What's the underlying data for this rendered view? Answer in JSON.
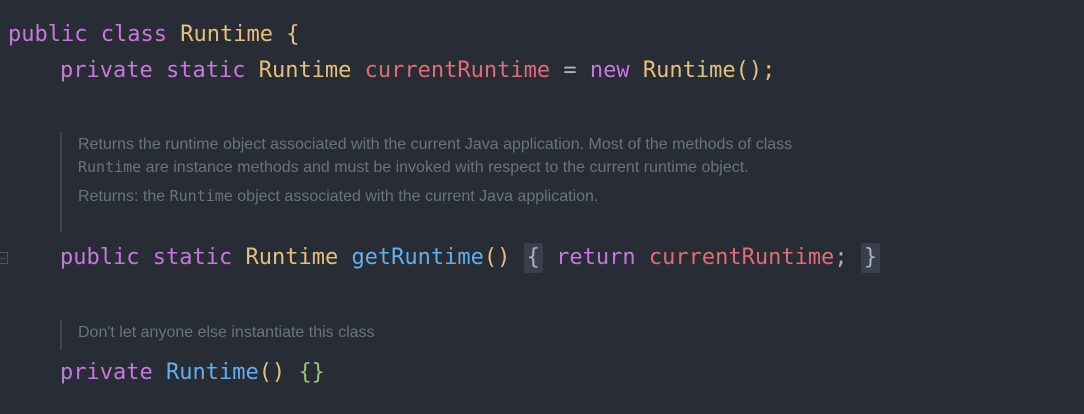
{
  "code": {
    "line1": {
      "kw_public": "public",
      "kw_class": "class",
      "class_name": "Runtime",
      "open_brace": "{"
    },
    "line2": {
      "kw_private": "private",
      "kw_static": "static",
      "type": "Runtime",
      "field": "currentRuntime",
      "eq": "=",
      "kw_new": "new",
      "ctor": "Runtime",
      "tail": "();"
    },
    "doc1": {
      "text_a": "Returns the runtime object associated with the current Java application. Most of the methods of class ",
      "code_a": "Runtime",
      "text_b": " are instance methods and must be invoked with respect to the current runtime object.",
      "returns_label": "Returns:",
      "returns_text_a": " the ",
      "returns_code": "Runtime",
      "returns_text_b": " object associated with the current Java application."
    },
    "line3": {
      "kw_public": "public",
      "kw_static": "static",
      "type": "Runtime",
      "method": "getRuntime",
      "parens": "()",
      "open_brace": "{",
      "kw_return": "return",
      "field": "currentRuntime",
      "semi": ";",
      "close_brace": "}"
    },
    "doc2": {
      "text": "Don't let anyone else instantiate this class"
    },
    "line4": {
      "kw_private": "private",
      "ctor": "Runtime",
      "parens": "()",
      "body": "{}"
    }
  },
  "theme": {
    "background": "#282c34",
    "keyword": "#c678dd",
    "type": "#e5c07b",
    "field": "#e06c75",
    "function": "#61afef",
    "doc": "#6b7280"
  }
}
